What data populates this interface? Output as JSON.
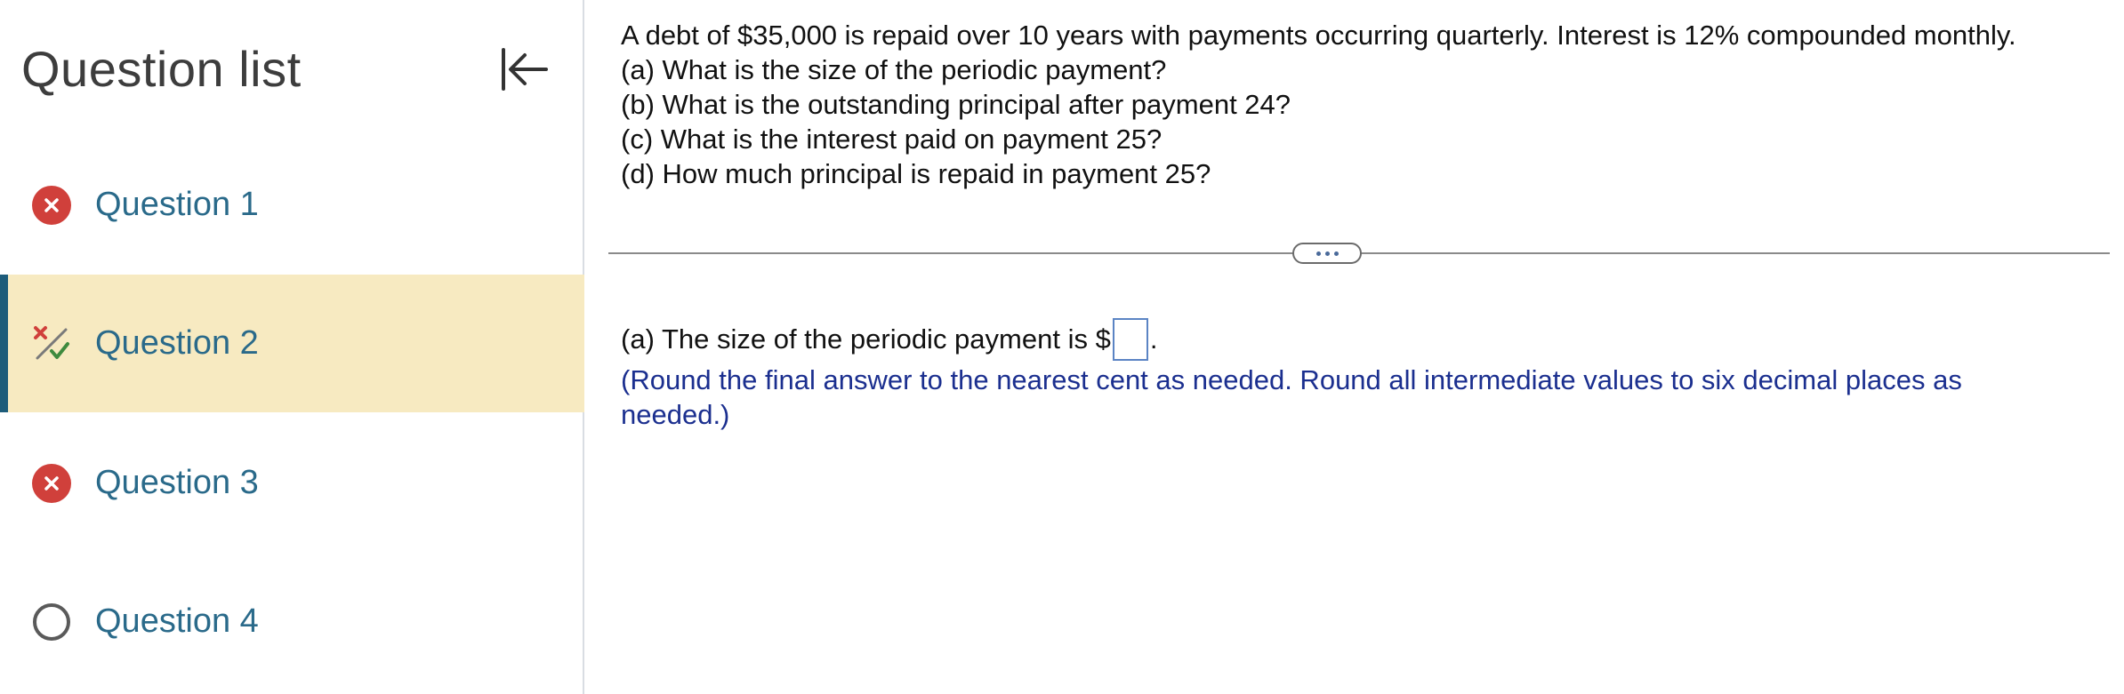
{
  "sidebar": {
    "title": "Question list",
    "collapse_icon": "collapse-left-icon",
    "items": [
      {
        "label": "Question 1",
        "status": "incorrect",
        "icon": "x-circle-icon"
      },
      {
        "label": "Question 2",
        "status": "partially-correct",
        "icon": "partial-credit-icon",
        "active": true
      },
      {
        "label": "Question 3",
        "status": "incorrect",
        "icon": "x-circle-icon"
      },
      {
        "label": "Question 4",
        "status": "unanswered",
        "icon": "empty-circle-icon"
      }
    ]
  },
  "question": {
    "lines": [
      "A debt of $35,000 is repaid over 10 years with payments occurring quarterly. Interest is 12% compounded monthly.",
      "(a) What is the size of the periodic payment?",
      "(b) What is the outstanding principal after payment 24?",
      "(c) What is the interest paid on payment 25?",
      "(d) How much principal is repaid in payment 25?"
    ]
  },
  "answer": {
    "prefix": "(a) The size of the periodic payment is $",
    "suffix": ".",
    "value": "",
    "hint": "(Round the final answer to the nearest cent as needed. Round all intermediate values to six decimal places as needed.)"
  },
  "colors": {
    "active_bg": "#f7eac1",
    "active_bar": "#1d5c7a",
    "link": "#2a6a8a",
    "incorrect": "#d0403b",
    "hint": "#1b2f8f"
  }
}
